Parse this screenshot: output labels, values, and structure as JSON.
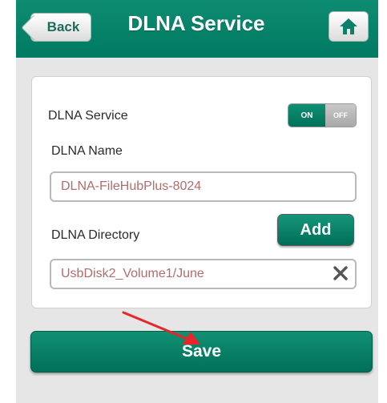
{
  "header": {
    "back_label": "Back",
    "title": "DLNA Service",
    "home_icon": "home-icon"
  },
  "form": {
    "service_label": "DLNA Service",
    "toggle": {
      "on_label": "ON",
      "off_label": "OFF",
      "state": "on"
    },
    "name_label": "DLNA Name",
    "name_value": "DLNA-FileHubPlus-8024",
    "directory_label": "DLNA Directory",
    "add_label": "Add",
    "directory_value": "UsbDisk2_Volume1/June",
    "clear_icon": "close-icon"
  },
  "footer": {
    "save_label": "Save"
  },
  "annotation": {
    "arrow_color": "#e8252b",
    "icon": "arrow-annotation"
  },
  "colors": {
    "primary": "#0e8c72",
    "field_text": "#b46b6b",
    "background": "#e6e6e6"
  }
}
